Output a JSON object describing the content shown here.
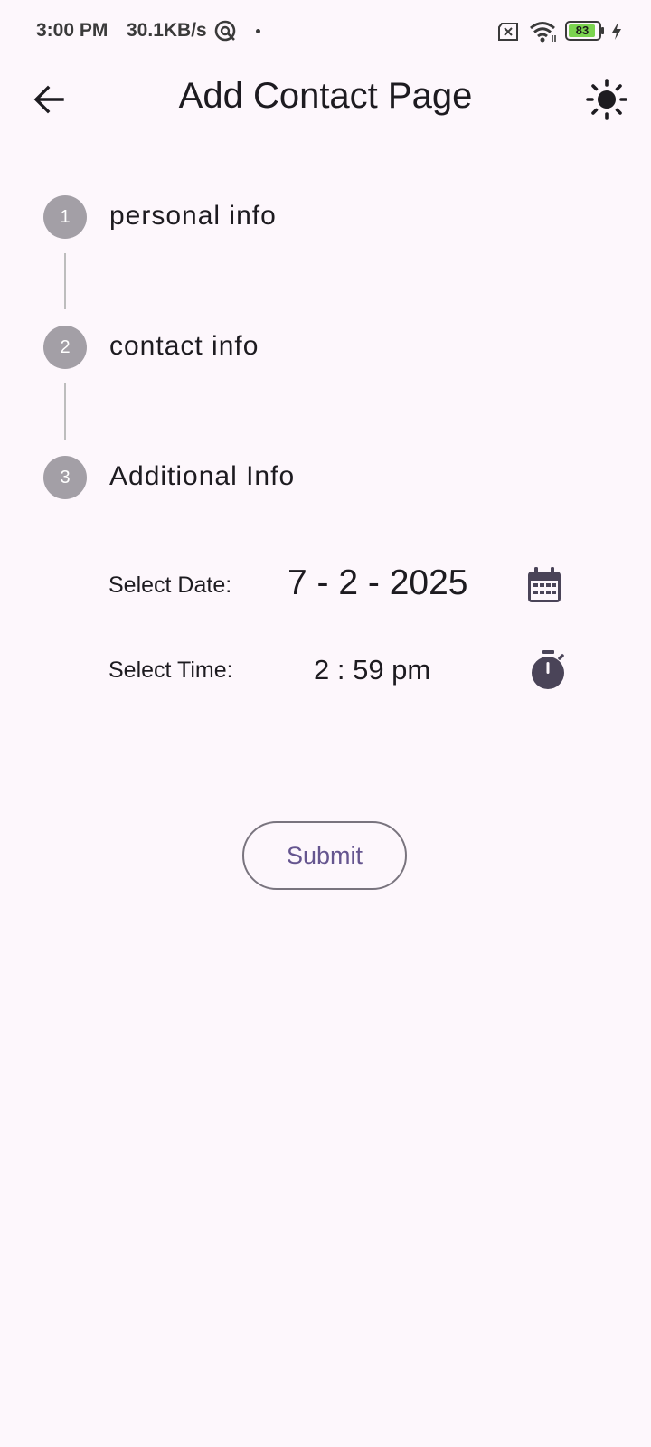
{
  "status_bar": {
    "time": "3:00 PM",
    "network_speed": "30.1KB/s",
    "battery_level": "83",
    "icons": [
      "vpn-icon",
      "sim-off-icon",
      "wifi-icon",
      "battery-icon",
      "charging-icon"
    ]
  },
  "app_bar": {
    "title": "Add Contact Page",
    "back_icon": "arrow-left-icon",
    "theme_icon": "sun-icon"
  },
  "stepper": {
    "steps": [
      {
        "number": "1",
        "label": "personal info"
      },
      {
        "number": "2",
        "label": "contact info"
      },
      {
        "number": "3",
        "label": "Additional Info"
      }
    ]
  },
  "form": {
    "date_label": "Select Date:",
    "date_value": "7 - 2 - 2025",
    "date_icon": "calendar-icon",
    "time_label": "Select Time:",
    "time_value": "2 : 59 pm",
    "time_icon": "timer-icon"
  },
  "actions": {
    "submit_label": "Submit"
  },
  "colors": {
    "background": "#FDF7FC",
    "step_circle": "#A39FA6",
    "primary_text": "#1D1B20",
    "button_text": "#65558F",
    "button_outline": "#79747E",
    "icon": "#4A4458"
  }
}
